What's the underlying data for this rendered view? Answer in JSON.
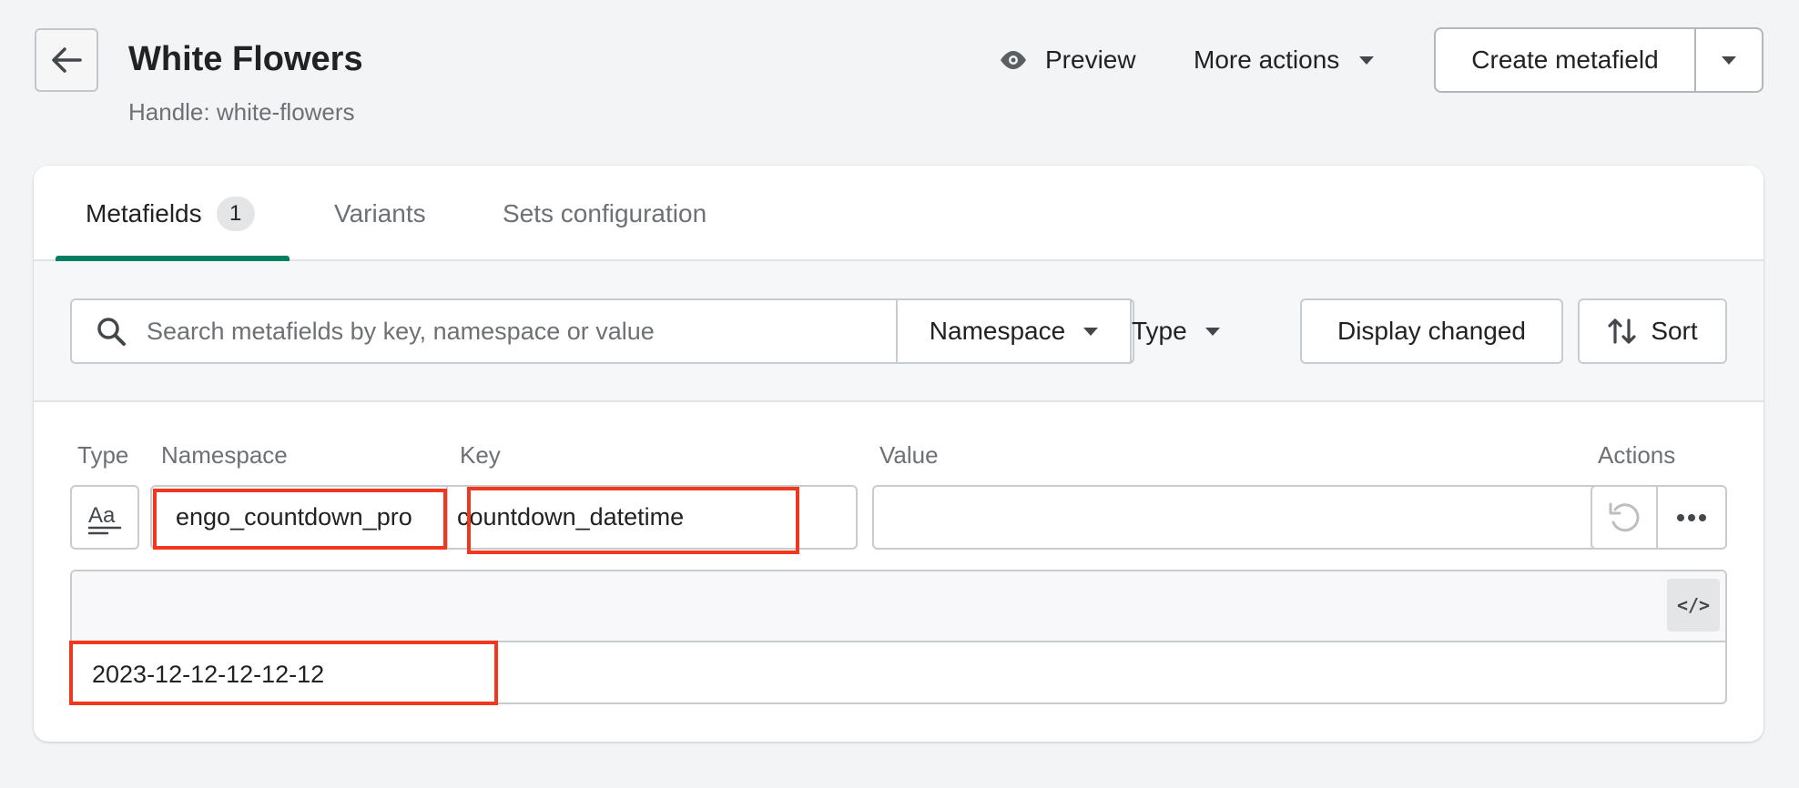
{
  "header": {
    "title": "White Flowers",
    "handle": "Handle: white-flowers",
    "preview_label": "Preview",
    "more_actions_label": "More actions",
    "create_label": "Create metafield"
  },
  "tabs": [
    {
      "label": "Metafields",
      "badge": "1",
      "active": true
    },
    {
      "label": "Variants",
      "active": false
    },
    {
      "label": "Sets configuration",
      "active": false
    }
  ],
  "filters": {
    "search_placeholder": "Search metafields by key, namespace or value",
    "namespace_label": "Namespace",
    "type_label": "Type",
    "display_changed_label": "Display changed",
    "sort_label": "Sort"
  },
  "columns": {
    "type": "Type",
    "namespace": "Namespace",
    "key": "Key",
    "value": "Value",
    "actions": "Actions"
  },
  "row": {
    "type_icon": "text-type-icon",
    "namespace": "engo_countdown_pro",
    "key": "countdown_datetime",
    "value": "",
    "editor_value": "2023-12-12-12-12-12"
  },
  "colors": {
    "accent": "#008060",
    "highlight": "#f1371d"
  }
}
